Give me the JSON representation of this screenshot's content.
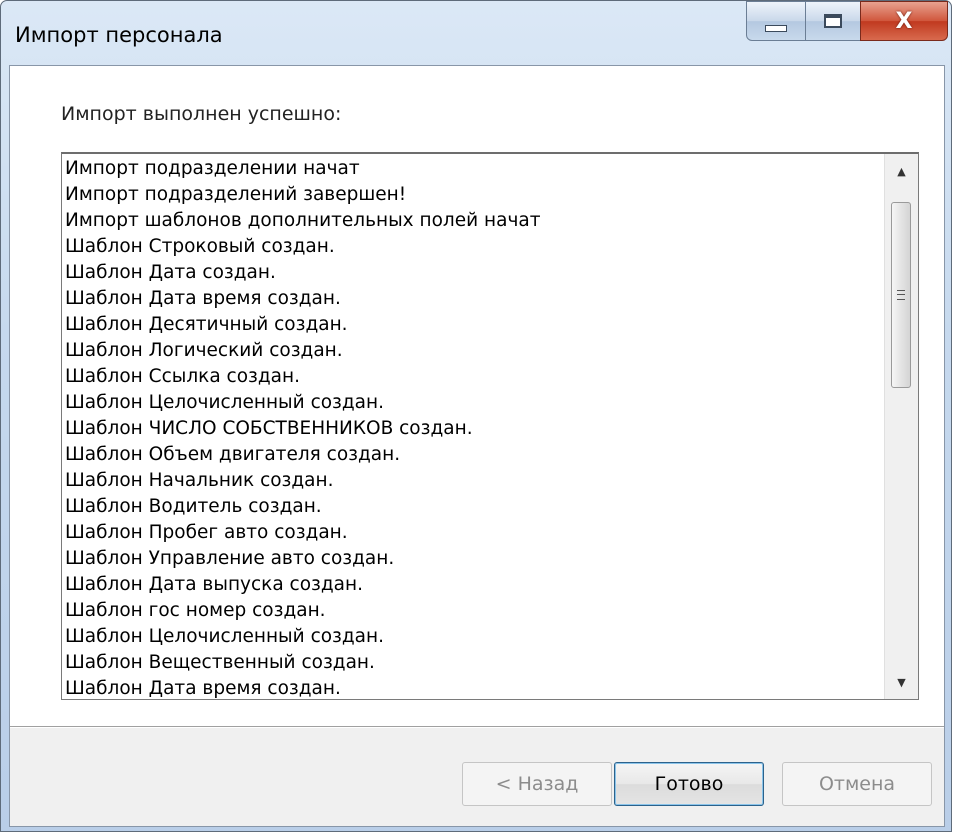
{
  "window": {
    "title": "Импорт персонала",
    "controls": {
      "minimize_icon": "minimize-icon",
      "maximize_icon": "maximize-icon",
      "close_glyph": "X"
    }
  },
  "content": {
    "heading": "Импорт выполнен успешно:",
    "log_lines": [
      "Импорт подразделении начат",
      "Импорт подразделений завершен!",
      "Импорт шаблонов дополнительных полей начат",
      "Шаблон Строковый создан.",
      "Шаблон Дата создан.",
      "Шаблон Дата время создан.",
      "Шаблон Десятичный создан.",
      "Шаблон Логический создан.",
      "Шаблон Ссылка создан.",
      "Шаблон Целочисленный создан.",
      "Шаблон ЧИСЛО СОБСТВЕННИКОВ создан.",
      "Шаблон Объем двигателя создан.",
      "Шаблон Начальник создан.",
      "Шаблон Водитель создан.",
      "Шаблон Пробег авто создан.",
      "Шаблон Управление авто создан.",
      "Шаблон Дата выпуска создан.",
      "Шаблон гос номер создан.",
      "Шаблон Целочисленный создан.",
      "Шаблон Вещественный создан.",
      "Шаблон Дата время создан."
    ]
  },
  "buttons": {
    "back": {
      "label": "< Назад",
      "enabled": false
    },
    "done": {
      "label": "Готово",
      "enabled": true,
      "default": true
    },
    "cancel": {
      "label": "Отмена",
      "enabled": false
    }
  },
  "colors": {
    "titlebar": "#c6d9ee",
    "close_button": "#c0391f",
    "default_button_border": "#2c628b"
  }
}
